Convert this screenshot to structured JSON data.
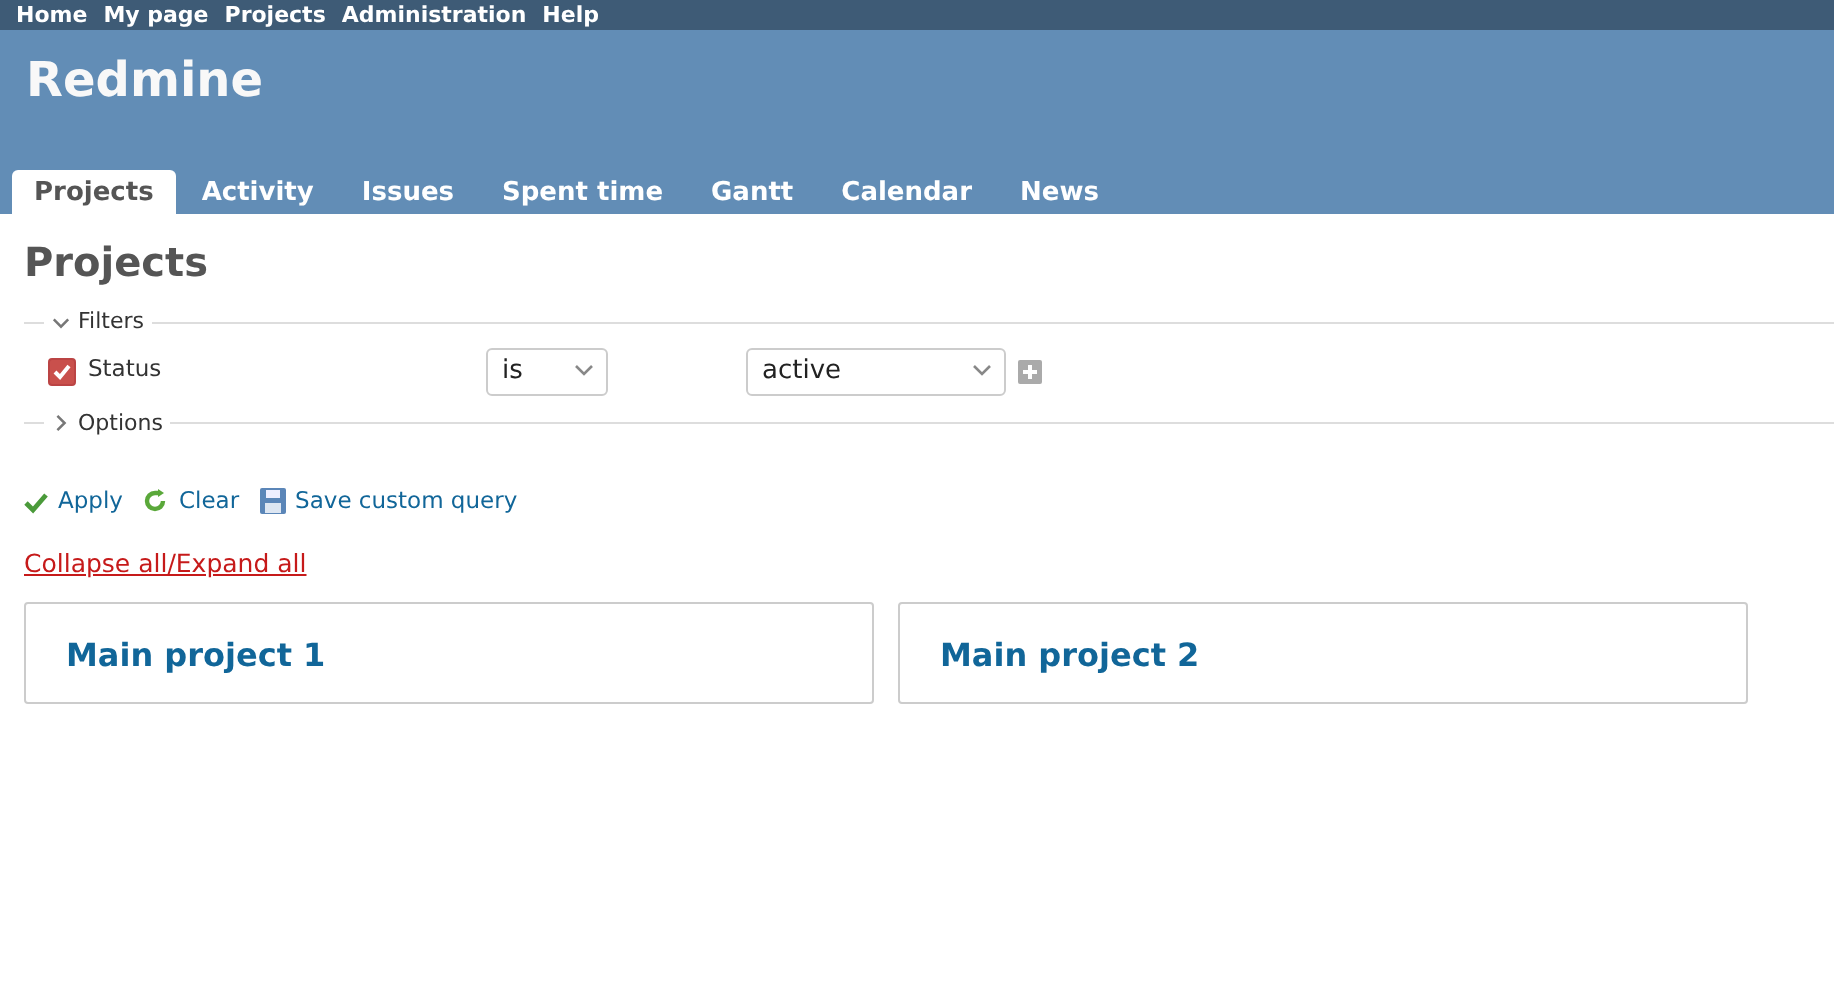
{
  "top_menu": [
    {
      "label": "Home"
    },
    {
      "label": "My page"
    },
    {
      "label": "Projects"
    },
    {
      "label": "Administration"
    },
    {
      "label": "Help"
    }
  ],
  "header": {
    "title": "Redmine"
  },
  "tabs": [
    {
      "label": "Projects",
      "selected": true
    },
    {
      "label": "Activity",
      "selected": false
    },
    {
      "label": "Issues",
      "selected": false
    },
    {
      "label": "Spent time",
      "selected": false
    },
    {
      "label": "Gantt",
      "selected": false
    },
    {
      "label": "Calendar",
      "selected": false
    },
    {
      "label": "News",
      "selected": false
    }
  ],
  "page_title": "Projects",
  "filters": {
    "legend": "Filters",
    "expanded": true,
    "rows": [
      {
        "label": "Status",
        "checked": true,
        "operator": "is",
        "value": "active"
      }
    ]
  },
  "options": {
    "legend": "Options",
    "expanded": false
  },
  "actions": [
    {
      "kind": "apply",
      "label": "Apply"
    },
    {
      "kind": "clear",
      "label": "Clear"
    },
    {
      "kind": "save",
      "label": "Save custom query"
    }
  ],
  "toggle_link": "Collapse all/Expand all",
  "projects": [
    {
      "name": "Main project 1"
    },
    {
      "name": "Main project 2"
    }
  ]
}
